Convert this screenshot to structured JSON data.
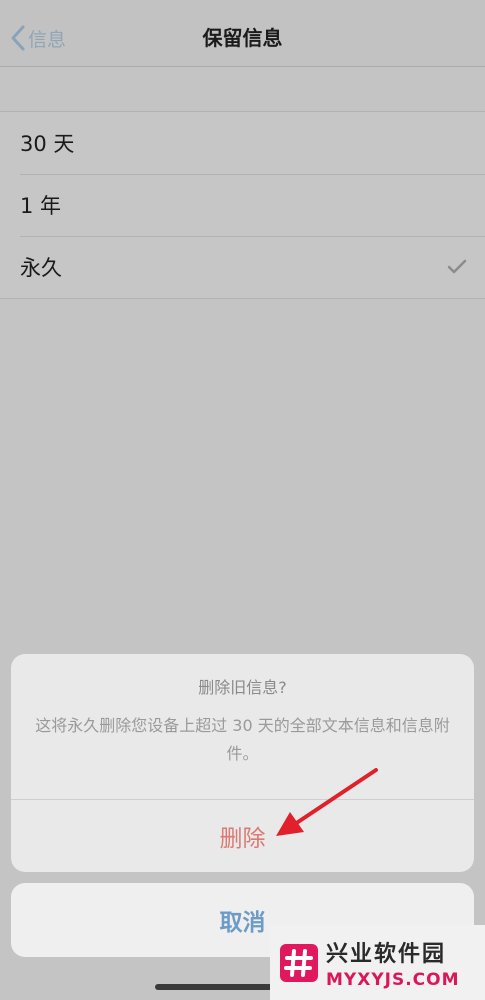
{
  "nav": {
    "back_label": "信息",
    "title": "保留信息"
  },
  "options": [
    {
      "label": "30 天",
      "selected": false
    },
    {
      "label": "1 年",
      "selected": false
    },
    {
      "label": "永久",
      "selected": true
    }
  ],
  "action_sheet": {
    "title": "删除旧信息?",
    "message": "这将永久删除您设备上超过 30 天的全部文本信息和信息附件。",
    "delete_label": "删除",
    "cancel_label": "取消"
  },
  "watermark": {
    "cn": "兴业软件园",
    "en": "MYXYJS.COM"
  },
  "colors": {
    "accent": "#6c9bc7",
    "destructive": "#dc7a72",
    "annotation": "#e0202a",
    "watermark_brand": "#d9185b"
  }
}
